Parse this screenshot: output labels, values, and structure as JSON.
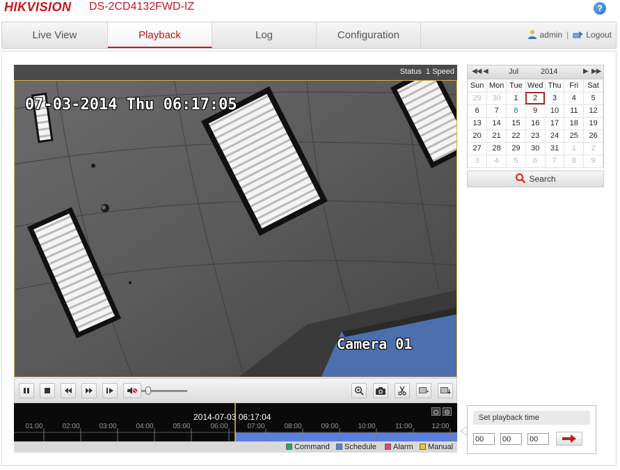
{
  "header": {
    "brand": "HIKVISION",
    "model": "DS-2CD4132FWD-IZ",
    "help_icon": "help-icon"
  },
  "nav": {
    "tabs": [
      {
        "label": "Live View",
        "active": false
      },
      {
        "label": "Playback",
        "active": true
      },
      {
        "label": "Log",
        "active": false
      },
      {
        "label": "Configuration",
        "active": false
      }
    ],
    "user": "admin",
    "divider": "|",
    "logout": "Logout"
  },
  "player": {
    "status_label": "Status",
    "speed_label": "1 Speed",
    "osd_timestamp": "07-03-2014 Thu 06:17:05",
    "osd_camera": "Camera 01",
    "volume_level": 0.1
  },
  "timeline": {
    "current_time": "2014-07-03 06:17:04",
    "hours": [
      "01:00",
      "02:00",
      "03:00",
      "04:00",
      "05:00",
      "06:00",
      "07:00",
      "08:00",
      "09:00",
      "10:00",
      "11:00",
      "12:00"
    ],
    "legend": [
      {
        "label": "Command",
        "color": "#26a65b"
      },
      {
        "label": "Schedule",
        "color": "#5b7fe0"
      },
      {
        "label": "Alarm",
        "color": "#e0446e"
      },
      {
        "label": "Manual",
        "color": "#f1c232"
      }
    ]
  },
  "calendar": {
    "month": "Jul",
    "year": "2014",
    "weekdays": [
      "Sun",
      "Mon",
      "Tue",
      "Wed",
      "Thu",
      "Fri",
      "Sat"
    ],
    "weeks": [
      [
        "29",
        "30",
        "1",
        "2",
        "3",
        "4",
        "5"
      ],
      [
        "6",
        "7",
        "8",
        "9",
        "10",
        "11",
        "12"
      ],
      [
        "13",
        "14",
        "15",
        "16",
        "17",
        "18",
        "19"
      ],
      [
        "20",
        "21",
        "22",
        "23",
        "24",
        "25",
        "26"
      ],
      [
        "27",
        "28",
        "29",
        "30",
        "31",
        "1",
        "2"
      ],
      [
        "3",
        "4",
        "5",
        "6",
        "7",
        "8",
        "9"
      ]
    ],
    "selected_day": "2",
    "recorded_day": "8",
    "search_label": "Search"
  },
  "playback_time": {
    "title": "Set playback time",
    "hour": "00",
    "minute": "00",
    "second": "00"
  },
  "colors": {
    "brand_red": "#c8161d",
    "schedule_blue": "#5b7fe0",
    "cursor_yellow": "#f1c232"
  }
}
